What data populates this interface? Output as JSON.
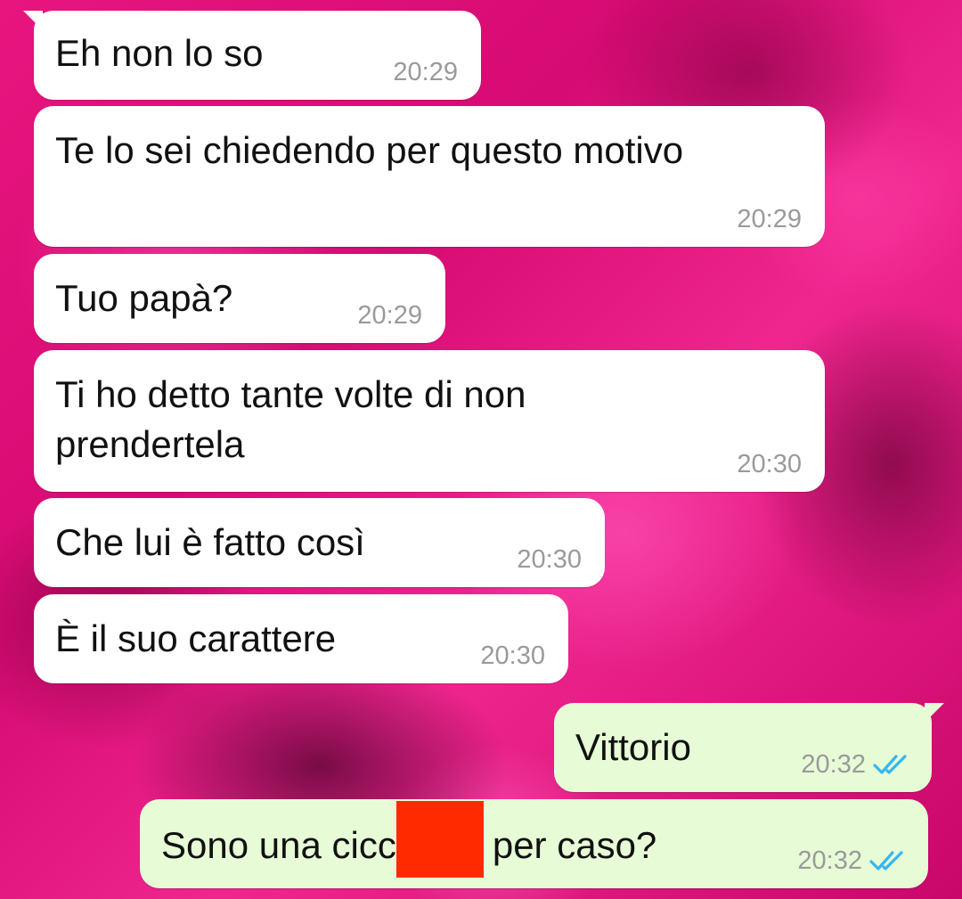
{
  "chat": {
    "messages": [
      {
        "direction": "incoming",
        "text": "Eh non lo so",
        "time": "20:29"
      },
      {
        "direction": "incoming",
        "text": "Te lo sei chiedendo per questo motivo",
        "time": "20:29"
      },
      {
        "direction": "incoming",
        "text": "Tuo papà?",
        "time": "20:29"
      },
      {
        "direction": "incoming",
        "text": "Ti ho detto tante volte di non prendertela",
        "time": "20:30"
      },
      {
        "direction": "incoming",
        "text": "Che lui è fatto così",
        "time": "20:30"
      },
      {
        "direction": "incoming",
        "text": "È il suo carattere",
        "time": "20:30"
      },
      {
        "direction": "outgoing",
        "text": "Vittorio",
        "time": "20:32",
        "status": "read"
      },
      {
        "direction": "outgoing",
        "text_before": "Sono una cicc",
        "text_after": "per caso?",
        "time": "20:32",
        "status": "read",
        "redacted": true
      }
    ]
  },
  "colors": {
    "incoming_bubble": "#ffffff",
    "outgoing_bubble": "#e7fbd7",
    "read_ticks": "#34b7f1",
    "redaction": "#ff2a00",
    "background": "#e8157f"
  },
  "icons": {
    "read_status": "double-check-icon"
  }
}
